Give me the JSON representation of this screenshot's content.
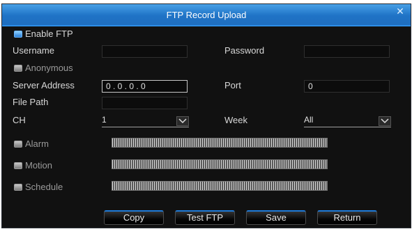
{
  "dialog": {
    "title": "FTP Record Upload",
    "close_icon": "close-icon"
  },
  "form": {
    "enable_ftp_label": "Enable FTP",
    "enable_ftp_checked": true,
    "username_label": "Username",
    "username_value": "",
    "password_label": "Password",
    "password_value": "",
    "anonymous_label": "Anonymous",
    "anonymous_checked": false,
    "server_address_label": "Server Address",
    "server_address_value": "0 . 0 . 0 . 0",
    "port_label": "Port",
    "port_value": "0",
    "file_path_label": "File Path",
    "file_path_value": "",
    "ch_label": "CH",
    "ch_value": "1",
    "week_label": "Week",
    "week_value": "All"
  },
  "schedule": {
    "alarm_label": "Alarm",
    "motion_label": "Motion",
    "schedule_label": "Schedule"
  },
  "buttons": {
    "copy": "Copy",
    "test_ftp": "Test FTP",
    "save": "Save",
    "return": "Return"
  },
  "colors": {
    "titlebar": "#1f73c6",
    "background": "#111111",
    "accent": "#1e7ad8"
  }
}
